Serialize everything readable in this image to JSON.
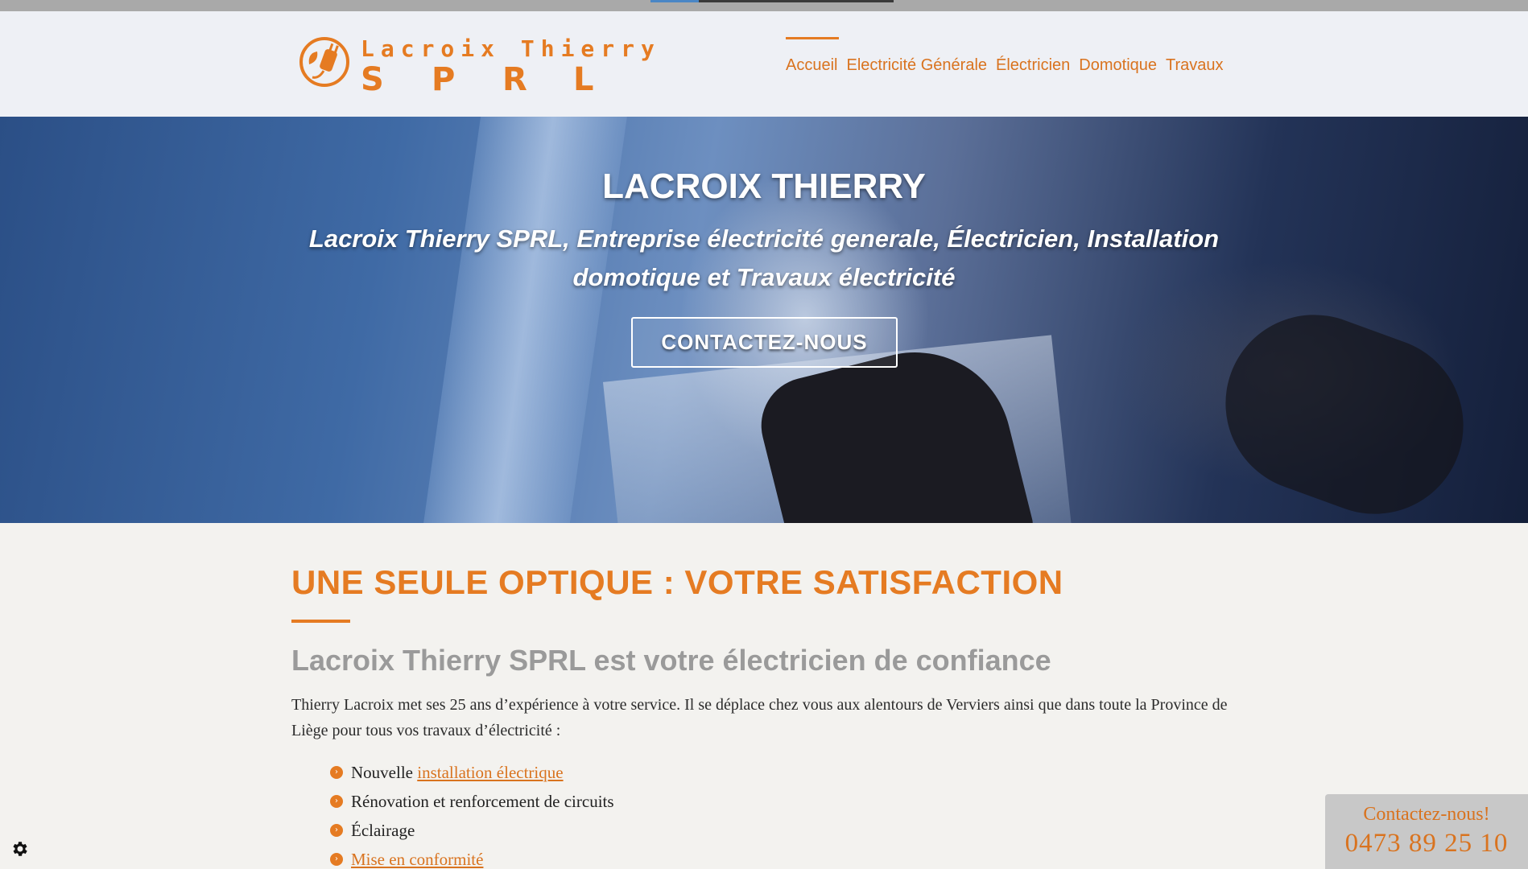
{
  "logo": {
    "line1": "Lacroix Thierry",
    "line2_letters": [
      "S",
      "P",
      "R",
      "L"
    ]
  },
  "nav": {
    "items": [
      {
        "label": "Accueil",
        "active": true
      },
      {
        "label": "Electricité Générale",
        "active": false
      },
      {
        "label": "Électricien",
        "active": false
      },
      {
        "label": "Domotique",
        "active": false
      },
      {
        "label": "Travaux",
        "active": false
      }
    ]
  },
  "hero": {
    "title": "LACROIX THIERRY",
    "subtitle": "Lacroix Thierry SPRL, Entreprise électricité generale, Électricien, Installation domotique et Travaux électricité",
    "cta_label": "CONTACTEZ-NOUS"
  },
  "main": {
    "heading": "UNE SEULE OPTIQUE : VOTRE SATISFACTION",
    "subheading": "Lacroix Thierry SPRL est votre électricien de confiance",
    "paragraph": "Thierry Lacroix met ses 25 ans d’expérience à votre service. Il se déplace chez vous aux alentours de Verviers ainsi que dans toute la Province de Liège pour tous vos travaux d’électricité :",
    "list": [
      {
        "prefix": "Nouvelle ",
        "link": "installation électrique",
        "text": ""
      },
      {
        "prefix": "Rénovation et renforcement de circuits",
        "link": "",
        "text": ""
      },
      {
        "prefix": "Éclairage",
        "link": "",
        "text": ""
      },
      {
        "prefix": "",
        "link": "Mise en conformité",
        "text": ""
      }
    ]
  },
  "contact_float": {
    "label": "Contactez-nous!",
    "phone": "0473 89 25 10"
  },
  "colors": {
    "accent": "#e57b22",
    "heading_gray": "#9a9a9a",
    "header_bg": "#eef0f5",
    "body_bg": "#f3f2ef"
  },
  "icons": {
    "logo_mark": "plug-icon",
    "cookie_settings": "gear-icon",
    "bullet": "chevron-right-icon"
  }
}
